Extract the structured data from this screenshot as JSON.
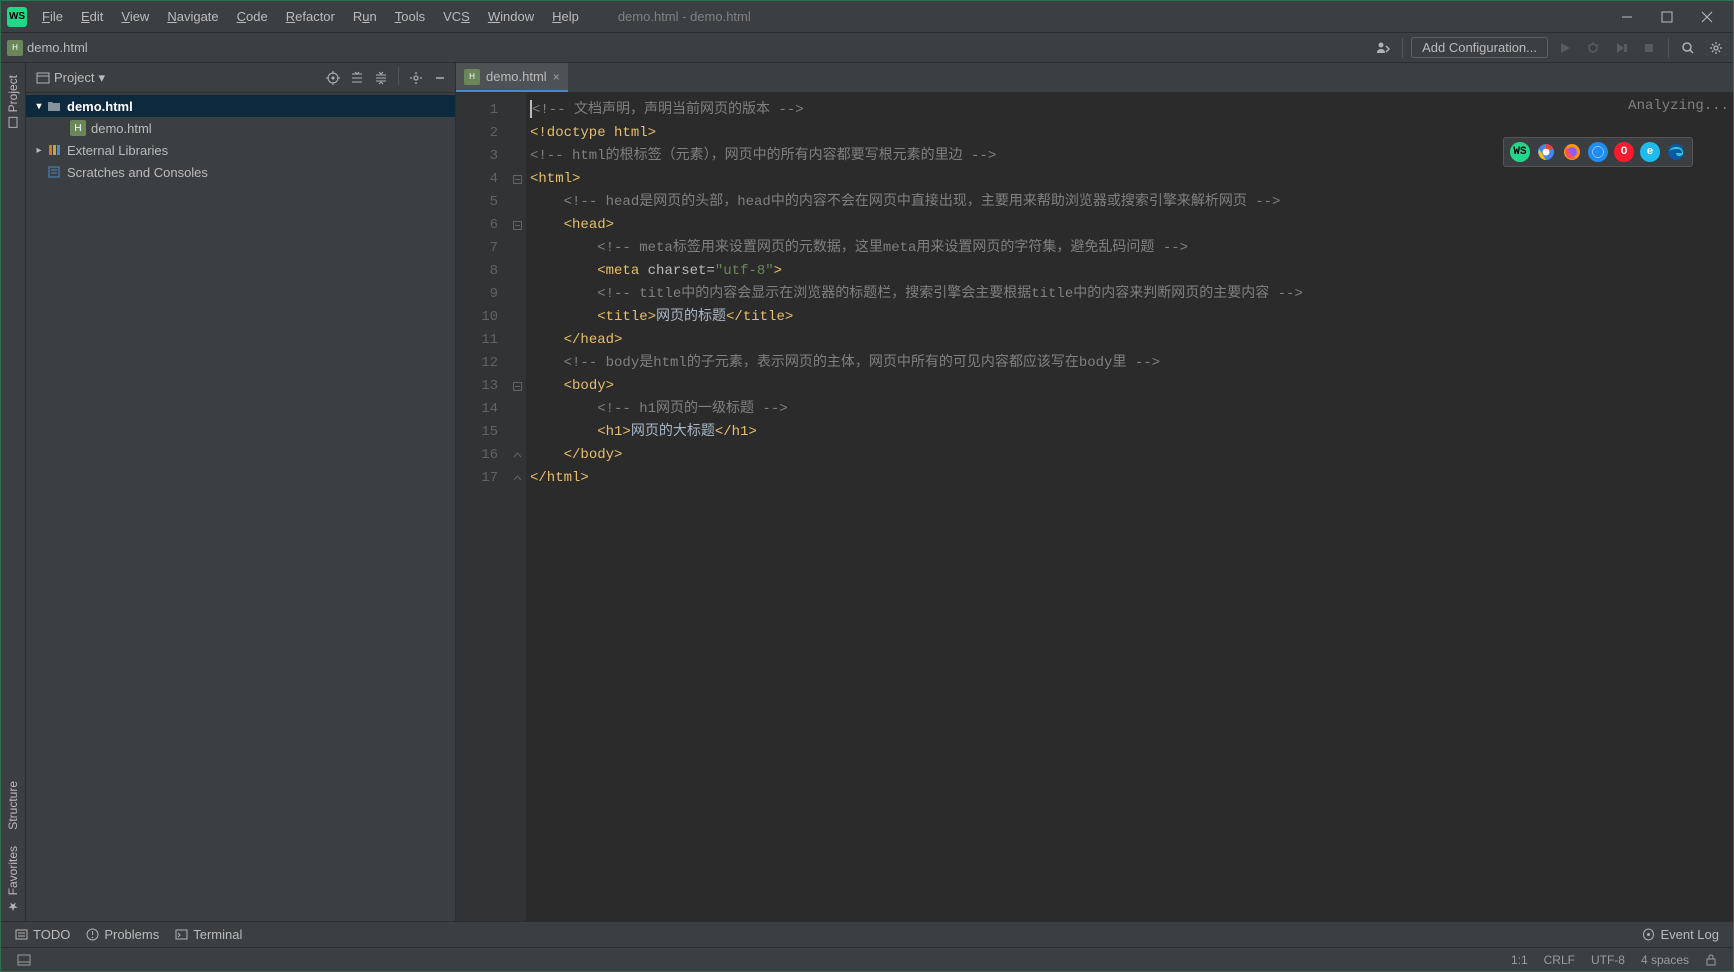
{
  "window_title": "demo.html - demo.html",
  "menubar": {
    "items": [
      {
        "label": "File",
        "u": "F"
      },
      {
        "label": "Edit",
        "u": "E"
      },
      {
        "label": "View",
        "u": "V"
      },
      {
        "label": "Navigate",
        "u": "N"
      },
      {
        "label": "Code",
        "u": "C"
      },
      {
        "label": "Refactor",
        "u": "R"
      },
      {
        "label": "Run",
        "u": "u"
      },
      {
        "label": "Tools",
        "u": "T"
      },
      {
        "label": "VCS",
        "u": "S"
      },
      {
        "label": "Window",
        "u": "W"
      },
      {
        "label": "Help",
        "u": "H"
      }
    ]
  },
  "navbar": {
    "file": "demo.html",
    "add_config": "Add Configuration..."
  },
  "left_gutter": {
    "project": "Project",
    "structure": "Structure",
    "favorites": "Favorites"
  },
  "project_panel": {
    "title": "Project",
    "tree": {
      "root": "demo.html",
      "file": "demo.html",
      "libs": "External Libraries",
      "scratches": "Scratches and Consoles"
    }
  },
  "tab": {
    "name": "demo.html"
  },
  "editor": {
    "analyzing": "Analyzing...",
    "line_count": 17,
    "html_lines": [
      {
        "indent": 0,
        "parts": [
          {
            "t": "comment",
            "v": "<!-- 文档声明，声明当前网页的版本 -->"
          }
        ]
      },
      {
        "indent": 0,
        "parts": [
          {
            "t": "doctype",
            "v": "<!doctype html>"
          }
        ]
      },
      {
        "indent": 0,
        "parts": [
          {
            "t": "comment",
            "v": "<!-- html的根标签（元素），网页中的所有内容都要写根元素的里边 -->"
          }
        ]
      },
      {
        "indent": 0,
        "parts": [
          {
            "t": "tag",
            "v": "<html>"
          }
        ]
      },
      {
        "indent": 1,
        "parts": [
          {
            "t": "comment",
            "v": "<!-- head是网页的头部，head中的内容不会在网页中直接出现，主要用来帮助浏览器或搜索引擎来解析网页 -->"
          }
        ]
      },
      {
        "indent": 1,
        "parts": [
          {
            "t": "tag",
            "v": "<head>"
          }
        ]
      },
      {
        "indent": 2,
        "parts": [
          {
            "t": "comment",
            "v": "<!-- meta标签用来设置网页的元数据，这里meta用来设置网页的字符集，避免乱码问题 -->"
          }
        ]
      },
      {
        "indent": 2,
        "parts": [
          {
            "t": "tag",
            "v": "<meta"
          },
          {
            "t": "text",
            "v": " "
          },
          {
            "t": "attr",
            "v": "charset="
          },
          {
            "t": "val",
            "v": "\"utf-8\""
          },
          {
            "t": "tag",
            "v": ">"
          }
        ]
      },
      {
        "indent": 2,
        "parts": [
          {
            "t": "comment",
            "v": "<!-- title中的内容会显示在浏览器的标题栏，搜索引擎会主要根据title中的内容来判断网页的主要内容 -->"
          }
        ]
      },
      {
        "indent": 2,
        "parts": [
          {
            "t": "tag",
            "v": "<title>"
          },
          {
            "t": "text",
            "v": "网页的标题"
          },
          {
            "t": "tag",
            "v": "</title>"
          }
        ]
      },
      {
        "indent": 1,
        "parts": [
          {
            "t": "tag",
            "v": "</head>"
          }
        ]
      },
      {
        "indent": 1,
        "parts": [
          {
            "t": "comment",
            "v": "<!-- body是html的子元素，表示网页的主体，网页中所有的可见内容都应该写在body里 -->"
          }
        ]
      },
      {
        "indent": 1,
        "parts": [
          {
            "t": "tag",
            "v": "<body>"
          }
        ]
      },
      {
        "indent": 2,
        "parts": [
          {
            "t": "comment",
            "v": "<!-- h1网页的一级标题 -->"
          }
        ]
      },
      {
        "indent": 2,
        "parts": [
          {
            "t": "tag",
            "v": "<h1>"
          },
          {
            "t": "text",
            "v": "网页的大标题"
          },
          {
            "t": "tag",
            "v": "</h1>"
          }
        ]
      },
      {
        "indent": 1,
        "parts": [
          {
            "t": "tag",
            "v": "</body>"
          }
        ]
      },
      {
        "indent": 0,
        "parts": [
          {
            "t": "tag",
            "v": "</html>"
          }
        ]
      }
    ],
    "fold_marks": {
      "4": "-",
      "6": "-",
      "13": "-",
      "16": "^",
      "17": "^"
    }
  },
  "bottom_tools": {
    "todo": "TODO",
    "problems": "Problems",
    "terminal": "Terminal",
    "event_log": "Event Log"
  },
  "statusbar": {
    "pos": "1:1",
    "line_sep": "CRLF",
    "encoding": "UTF-8",
    "indent": "4 spaces"
  },
  "browsers": [
    "WS",
    "Ch",
    "FF",
    "Sa",
    "Op",
    "IE",
    "Ed"
  ]
}
